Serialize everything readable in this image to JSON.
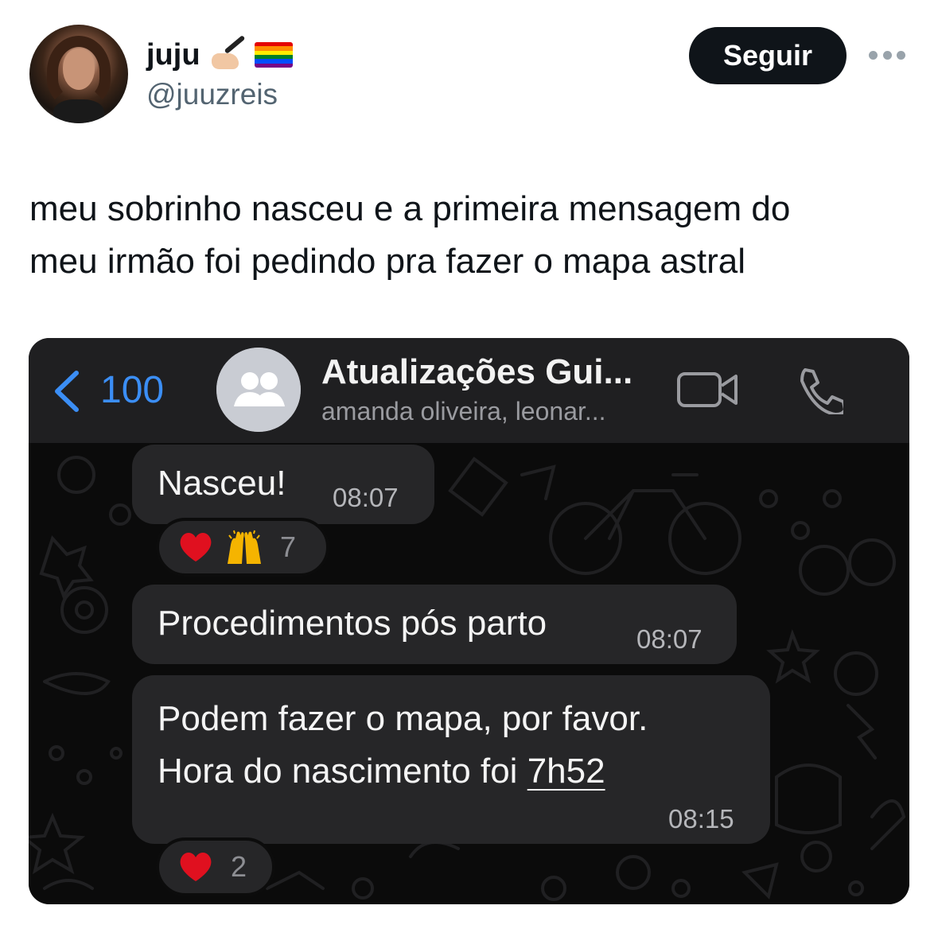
{
  "tweet": {
    "display_name": "juju",
    "name_emojis": [
      "writing-hand-icon",
      "rainbow-flag-icon"
    ],
    "handle": "@juuzreis",
    "follow_label": "Seguir",
    "text_lines": [
      "meu sobrinho nasceu e a primeira mensagem do",
      "meu irmão foi pedindo pra fazer o mapa astral"
    ]
  },
  "chat": {
    "back_count": "100",
    "title": "Atualizações Gui...",
    "subtitle": "amanda oliveira, leonar...",
    "messages": [
      {
        "text": "Nasceu!",
        "time": "08:07",
        "reactions": {
          "emojis": [
            "heart-icon",
            "raising-hands-icon"
          ],
          "count": "7"
        }
      },
      {
        "text": "Procedimentos pós parto",
        "time": "08:07"
      },
      {
        "line1": "Podem fazer o mapa, por favor.",
        "line2_prefix": "Hora do nascimento foi ",
        "line2_link": "7h52",
        "time": "08:15",
        "reactions": {
          "emojis": [
            "heart-icon"
          ],
          "count": "2"
        }
      }
    ]
  },
  "colors": {
    "follow_button_bg": "#0f1419",
    "handle_text": "#536471",
    "ios_blue": "#3b8ef5",
    "chat_bubble": "#262628",
    "chat_header": "#1f1f21",
    "heart": "#e0101f"
  }
}
